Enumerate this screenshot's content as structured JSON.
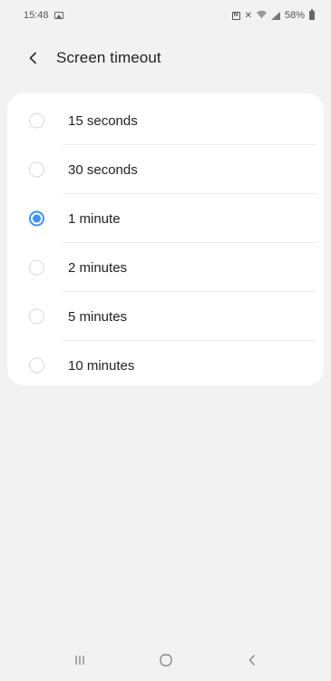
{
  "status_bar": {
    "time": "15:48",
    "battery": "58%"
  },
  "header": {
    "title": "Screen timeout"
  },
  "options": [
    {
      "label": "15 seconds",
      "selected": false
    },
    {
      "label": "30 seconds",
      "selected": false
    },
    {
      "label": "1 minute",
      "selected": true
    },
    {
      "label": "2 minutes",
      "selected": false
    },
    {
      "label": "5 minutes",
      "selected": false
    },
    {
      "label": "10 minutes",
      "selected": false
    }
  ],
  "colors": {
    "accent": "#3e91ff",
    "background": "#f2f2f2",
    "card": "#ffffff"
  },
  "icons": {
    "back": "chevron-left-icon",
    "recents": "recents-icon",
    "home": "home-icon",
    "nav_back": "back-icon"
  }
}
